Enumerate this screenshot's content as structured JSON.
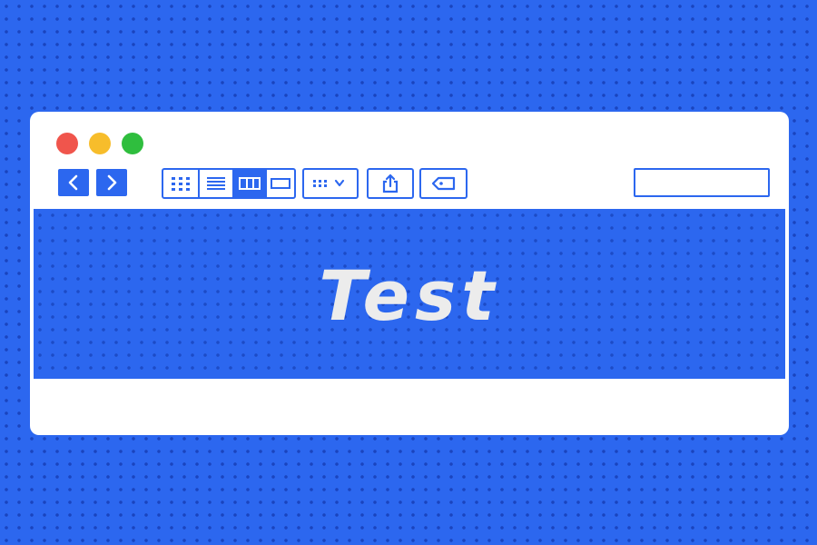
{
  "window": {
    "controls": [
      "close",
      "minimize",
      "zoom"
    ],
    "colors": {
      "close": "#f0554c",
      "minimize": "#f7bd2b",
      "zoom": "#2fbe3e",
      "accent": "#2c67ef"
    }
  },
  "toolbar": {
    "back_icon": "chevron-left-icon",
    "forward_icon": "chevron-right-icon",
    "view_modes": [
      "icon-view",
      "list-view",
      "column-view",
      "gallery-view"
    ],
    "active_view": "column-view",
    "group_by_icon": "group-by-icon",
    "share_icon": "share-icon",
    "tag_icon": "tag-icon",
    "search": {
      "placeholder": "",
      "value": "",
      "icon": "search-icon"
    }
  },
  "content": {
    "hero_text": "Test"
  }
}
